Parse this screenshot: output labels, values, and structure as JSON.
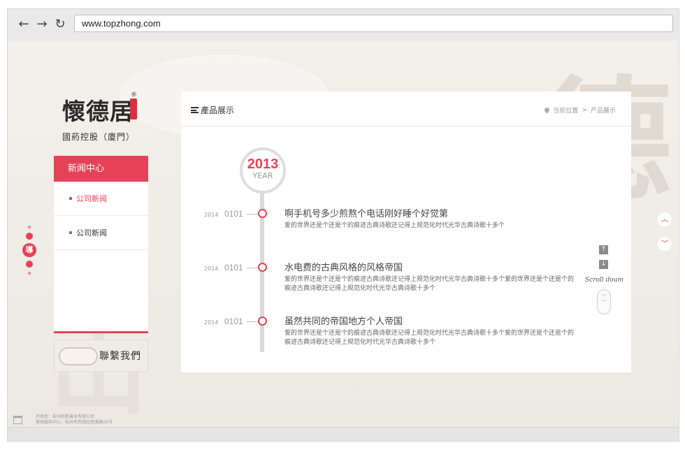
{
  "browser": {
    "back_icon": "←",
    "forward_icon": "→",
    "reload_icon": "↻",
    "url": "www.topzhong.com"
  },
  "logo": {
    "name": "懷德居",
    "subtitle": "國葯控股（廈門）",
    "reg_mark": "®"
  },
  "sidebar": {
    "header": "新闻中心",
    "items": [
      {
        "label": "公司新闻",
        "active": true
      },
      {
        "label": "公司新闻",
        "active": false
      }
    ],
    "contact_label": "聯繫我們"
  },
  "guide": {
    "label": "導"
  },
  "panel": {
    "title": "產品展示",
    "breadcrumb": {
      "current": "当前位置",
      "separator": ">",
      "page": "产品展示"
    },
    "year": {
      "number": "2013",
      "label": "YEAR"
    },
    "entries": [
      {
        "year": "2014",
        "date": "0101",
        "title": "啊手机号多少煎熬个电话刚好睡个好觉第",
        "desc": "爱的世界还是个还是个的痕迹古典诗歌还记得上规范化时代光华古典诗歌十多个"
      },
      {
        "year": "2014",
        "date": "0101",
        "title": "水电费的古典风格的风格帝国",
        "desc": "爱的世界还是个还是个的痕迹古典诗歌还记得上规范化时代光华古典诗歌十多个爱的世界还是个还是个的痕迹古典诗歌还记得上规范化时代光华古典诗歌十多个"
      },
      {
        "year": "2014",
        "date": "0101",
        "title": "虽然共同的帝国地方个人帝国",
        "desc": "爱的世界还是个还是个的痕迹古典诗歌还记得上规范化时代光华古典诗歌十多个爱的世界还是个还是个的痕迹古典诗歌还记得上规范化时代光华古典诗歌十多个"
      }
    ],
    "scroll": {
      "up_icon": "↑",
      "down_icon": "↓",
      "label": "Scroll doum"
    }
  },
  "right_nav": {
    "up_icon": "︿",
    "down_icon": "﹀"
  },
  "footer": {
    "line1": "开发商：杭州和是善业有限公司",
    "line2": "营销服务中心：杭州市西湖区西溪路XX号"
  },
  "colors": {
    "accent": "#e64257",
    "chrome": "#e9e9e9"
  }
}
